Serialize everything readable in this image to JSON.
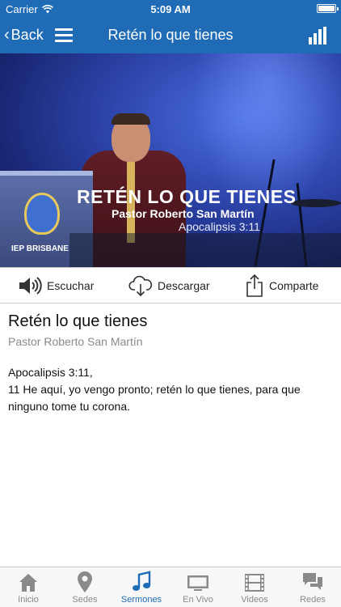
{
  "status_bar": {
    "carrier": "Carrier",
    "time": "5:09 AM"
  },
  "nav": {
    "back_label": "Back",
    "title": "Retén lo que tienes"
  },
  "hero": {
    "title": "RETÉN LO QUE TIENES",
    "pastor": "Pastor Roberto San Martín",
    "verse": "Apocalipsis 3:11",
    "podium_text": "IEP BRISBANE"
  },
  "actions": [
    {
      "label": "Escuchar",
      "icon": "speaker-icon"
    },
    {
      "label": "Descargar",
      "icon": "cloud-download-icon"
    },
    {
      "label": "Comparte",
      "icon": "share-icon"
    }
  ],
  "detail": {
    "title": "Retén lo que tienes",
    "pastor": "Pastor Roberto San Martín",
    "body_line1": "Apocalipsis 3:11,",
    "body_line2": "11 He aquí, yo vengo pronto; retén lo que tienes, para que ninguno tome tu corona."
  },
  "tabs": [
    {
      "label": "Inicio",
      "icon": "home-icon",
      "active": false
    },
    {
      "label": "Sedes",
      "icon": "map-pin-icon",
      "active": false
    },
    {
      "label": "Sermones",
      "icon": "music-note-icon",
      "active": true
    },
    {
      "label": "En Vivo",
      "icon": "tv-icon",
      "active": false
    },
    {
      "label": "Videos",
      "icon": "film-icon",
      "active": false
    },
    {
      "label": "Redes",
      "icon": "chat-bubbles-icon",
      "active": false
    }
  ],
  "colors": {
    "accent": "#1f6bb5",
    "tab_inactive": "#8a8a8a",
    "subtitle": "#8a8a8a"
  }
}
